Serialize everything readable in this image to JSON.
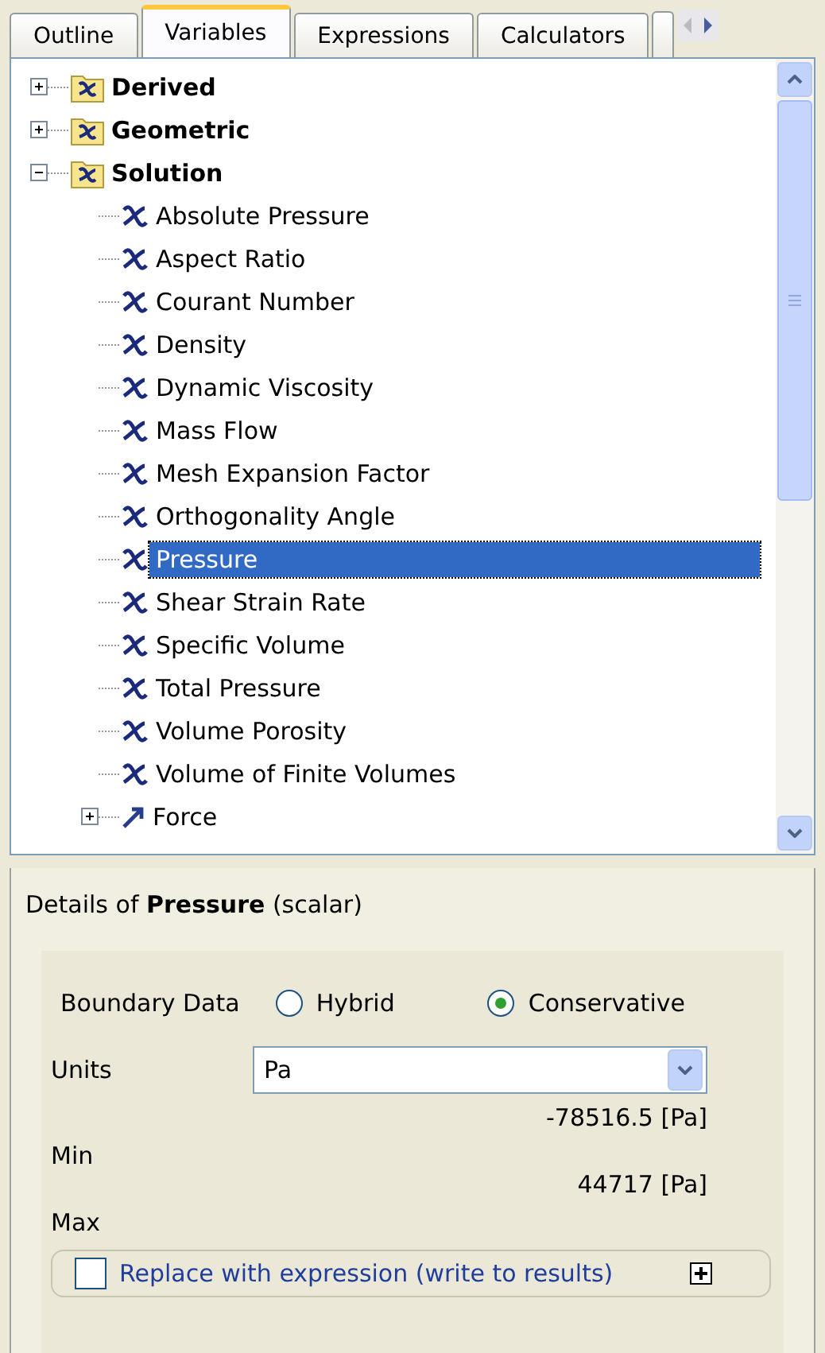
{
  "tabs": [
    {
      "label": "Outline",
      "selected": false
    },
    {
      "label": "Variables",
      "selected": true
    },
    {
      "label": "Expressions",
      "selected": false
    },
    {
      "label": "Calculators",
      "selected": false
    }
  ],
  "tree": [
    {
      "label": "Derived",
      "kind": "folder",
      "expanded": false,
      "selected": false
    },
    {
      "label": "Geometric",
      "kind": "folder",
      "expanded": false,
      "selected": false
    },
    {
      "label": "Solution",
      "kind": "folder",
      "expanded": true,
      "selected": false,
      "children": [
        {
          "label": "Absolute Pressure",
          "kind": "variable",
          "selected": false
        },
        {
          "label": "Aspect Ratio",
          "kind": "variable",
          "selected": false
        },
        {
          "label": "Courant Number",
          "kind": "variable",
          "selected": false
        },
        {
          "label": "Density",
          "kind": "variable",
          "selected": false
        },
        {
          "label": "Dynamic Viscosity",
          "kind": "variable",
          "selected": false
        },
        {
          "label": "Mass Flow",
          "kind": "variable",
          "selected": false
        },
        {
          "label": "Mesh Expansion Factor",
          "kind": "variable",
          "selected": false
        },
        {
          "label": "Orthogonality Angle",
          "kind": "variable",
          "selected": false
        },
        {
          "label": "Pressure",
          "kind": "variable",
          "selected": true
        },
        {
          "label": "Shear Strain Rate",
          "kind": "variable",
          "selected": false
        },
        {
          "label": "Specific Volume",
          "kind": "variable",
          "selected": false
        },
        {
          "label": "Total Pressure",
          "kind": "variable",
          "selected": false
        },
        {
          "label": "Volume Porosity",
          "kind": "variable",
          "selected": false
        },
        {
          "label": "Volume of Finite Volumes",
          "kind": "variable",
          "selected": false
        },
        {
          "label": "Force",
          "kind": "vector",
          "expanded": false,
          "selected": false
        }
      ]
    }
  ],
  "details": {
    "title": "Details of **Pressure** (scalar)",
    "boundary_label": "Boundary Data",
    "boundary_options": [
      {
        "label": "Hybrid",
        "selected": false
      },
      {
        "label": "Conservative",
        "selected": true
      }
    ],
    "units_label": "Units",
    "units_value": "Pa",
    "min_label": "Min",
    "min_value": "-78516.5 [Pa]",
    "max_label": "Max",
    "max_value": "44717 [Pa]",
    "replace": {
      "label": "Replace with expression (write to results)",
      "checked": false
    }
  }
}
